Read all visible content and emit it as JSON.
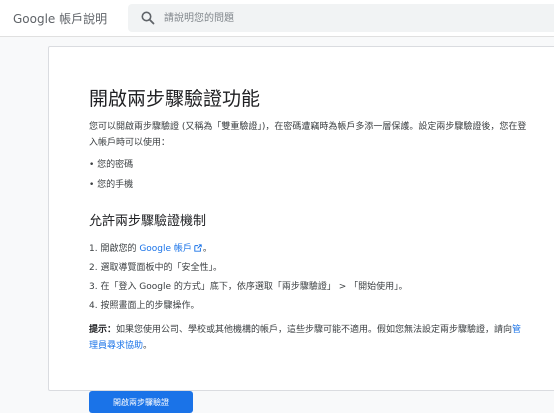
{
  "header": {
    "brand": "Google 帳戶說明",
    "search": {
      "placeholder": "請說明您的問題",
      "icon": "search-icon"
    }
  },
  "article": {
    "title": "開啟兩步驟驗證功能",
    "intro": "您可以開啟兩步驟驗證 (又稱為「雙重驗證」)，在密碼遭竊時為帳戶多添一層保護。設定兩步驟驗證後，您在登入帳戶時可以使用：",
    "bullets": [
      "您的密碼",
      "您的手機"
    ],
    "section_title": "允許兩步驟驗證機制",
    "steps": {
      "step1_prefix": "1. 開啟您的 ",
      "step1_link": "Google 帳戶",
      "step1_suffix": "。",
      "step2": "2. 選取導覽面板中的「安全性」。",
      "step3": "3. 在「登入 Google 的方式」底下，依序選取「兩步驟驗證」 > 「開始使用」。",
      "step4": "4. 按照畫面上的步驟操作。"
    },
    "tip": {
      "label": "提示：",
      "text": "如果您使用公司、學校或其他機構的帳戶，這些步驟可能不適用。假如您無法設定兩步驟驗證，請向",
      "link": "管理員尋求協助",
      "suffix": "。"
    },
    "cta_label": "開啟兩步驟驗證"
  },
  "colors": {
    "accent": "#1a73e8",
    "page_bg": "#f8f9fa"
  }
}
